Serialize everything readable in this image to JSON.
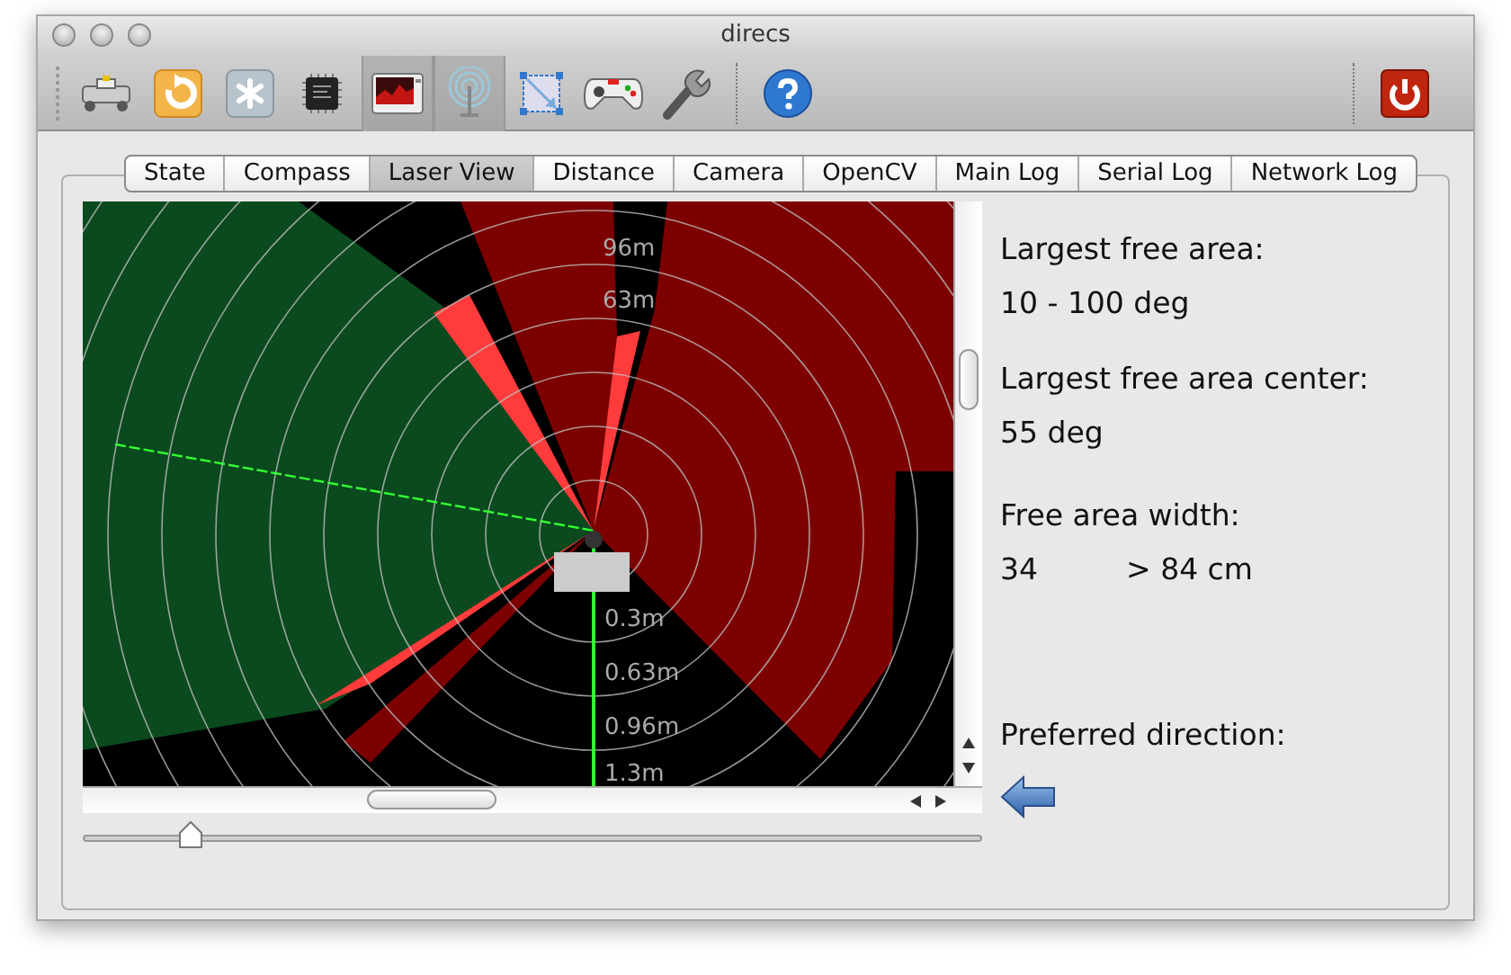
{
  "window": {
    "title": "direcs"
  },
  "toolbar": [
    {
      "kind": "robot",
      "on": false
    },
    {
      "kind": "refresh",
      "on": false
    },
    {
      "kind": "asterisk",
      "on": false
    },
    {
      "kind": "chip",
      "on": false
    },
    {
      "kind": "monitor",
      "on": true
    },
    {
      "kind": "antenna",
      "on": true
    },
    {
      "kind": "resize",
      "on": false
    },
    {
      "kind": "gamepad",
      "on": false
    },
    {
      "kind": "wrench",
      "on": false
    },
    {
      "kind": "help",
      "on": false
    },
    {
      "kind": "power",
      "on": false
    }
  ],
  "tabs": [
    {
      "label": "State",
      "selected": false
    },
    {
      "label": "Compass",
      "selected": false
    },
    {
      "label": "Laser View",
      "selected": true
    },
    {
      "label": "Distance",
      "selected": false
    },
    {
      "label": "Camera",
      "selected": false
    },
    {
      "label": "OpenCV",
      "selected": false
    },
    {
      "label": "Main Log",
      "selected": false
    },
    {
      "label": "Serial Log",
      "selected": false
    },
    {
      "label": "Network Log",
      "selected": false
    }
  ],
  "laser_view": {
    "range_labels": [
      "96m",
      "63m",
      "0.3m",
      "0.63m",
      "0.96m",
      "1.3m"
    ],
    "zoom_slider": {
      "level": 0.12
    }
  },
  "info": [
    {
      "label": "Largest free area:",
      "value": "10 - 100 deg"
    },
    {
      "label": "Largest free area center:",
      "value": "55 deg"
    },
    {
      "label": "Free area width:",
      "value": "34",
      "value_2": "> 84 cm"
    }
  ],
  "preferred_direction": {
    "label": "Preferred direction:"
  }
}
